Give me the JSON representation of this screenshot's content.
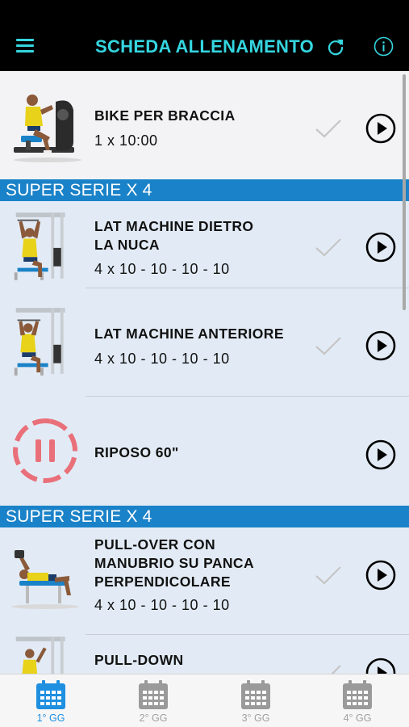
{
  "header": {
    "title": "SCHEDA ALLENAMENTO",
    "menu_icon": "hamburger-menu-icon",
    "refresh_icon": "refresh-icon",
    "info_icon": "info-icon",
    "accent": "#35d6e0"
  },
  "sections": [
    {
      "label": "SUPER SERIE X 4"
    },
    {
      "label": "SUPER SERIE X 4"
    }
  ],
  "exercises": [
    {
      "name": "BIKE PER BRACCIA",
      "sets": "1 x 10:00",
      "thumb": "arm-bike-exercise-icon"
    },
    {
      "name": "LAT MACHINE DIETRO LA NUCA",
      "name_lines": [
        "LAT MACHINE DIETRO",
        "LA NUCA"
      ],
      "sets": "4 x 10 - 10 - 10 - 10",
      "thumb": "lat-machine-exercise-icon"
    },
    {
      "name": "LAT MACHINE ANTERIORE",
      "sets": "4 x 10 - 10 - 10 - 10",
      "thumb": "lat-machine-front-exercise-icon"
    },
    {
      "name": "RIPOSO 60\"",
      "sets": "",
      "thumb": "rest-timer-icon"
    },
    {
      "name": "PULL-OVER CON MANUBRIO SU PANCA PERPENDICOLARE",
      "name_lines": [
        "PULL-OVER CON",
        "MANUBRIO SU PANCA",
        "PERPENDICOLARE"
      ],
      "sets": "4 x 10 - 10 - 10 - 10",
      "thumb": "pullover-bench-exercise-icon"
    },
    {
      "name": "PULL-DOWN",
      "sets": "",
      "thumb": "pulldown-exercise-icon"
    }
  ],
  "tabs": [
    {
      "label": "1° GG",
      "active": true
    },
    {
      "label": "2° GG",
      "active": false
    },
    {
      "label": "3° GG",
      "active": false
    },
    {
      "label": "4° GG",
      "active": false
    }
  ],
  "colors": {
    "section_bar": "#1a82c8",
    "rest_icon": "#e9707a",
    "tab_active": "#1f8fe0",
    "tab_inactive": "#a0a0a0"
  }
}
